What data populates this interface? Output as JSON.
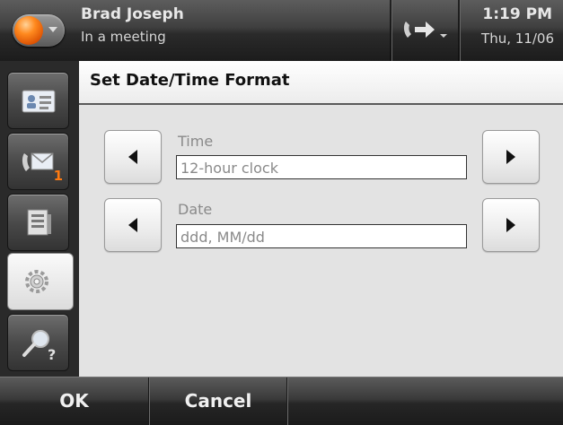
{
  "header": {
    "user_name": "Brad Joseph",
    "user_status": "In a meeting",
    "time": "1:19 PM",
    "date": "Thu, 11/06",
    "presence_color": "#ff8a1f"
  },
  "sidebar": {
    "items": [
      {
        "name": "contacts",
        "icon": "contact-card-icon",
        "badge": ""
      },
      {
        "name": "voicemail",
        "icon": "voicemail-envelope-icon",
        "badge": "1"
      },
      {
        "name": "call-log",
        "icon": "call-log-list-icon",
        "badge": ""
      },
      {
        "name": "settings",
        "icon": "gear-icon",
        "badge": "",
        "active": true
      },
      {
        "name": "search",
        "icon": "search-help-icon",
        "badge": ""
      }
    ]
  },
  "panel": {
    "title": "Set Date/Time Format",
    "time_label": "Time",
    "time_value": "12-hour clock",
    "date_label": "Date",
    "date_value": "ddd, MM/dd"
  },
  "softkeys": {
    "ok": "OK",
    "cancel": "Cancel"
  }
}
